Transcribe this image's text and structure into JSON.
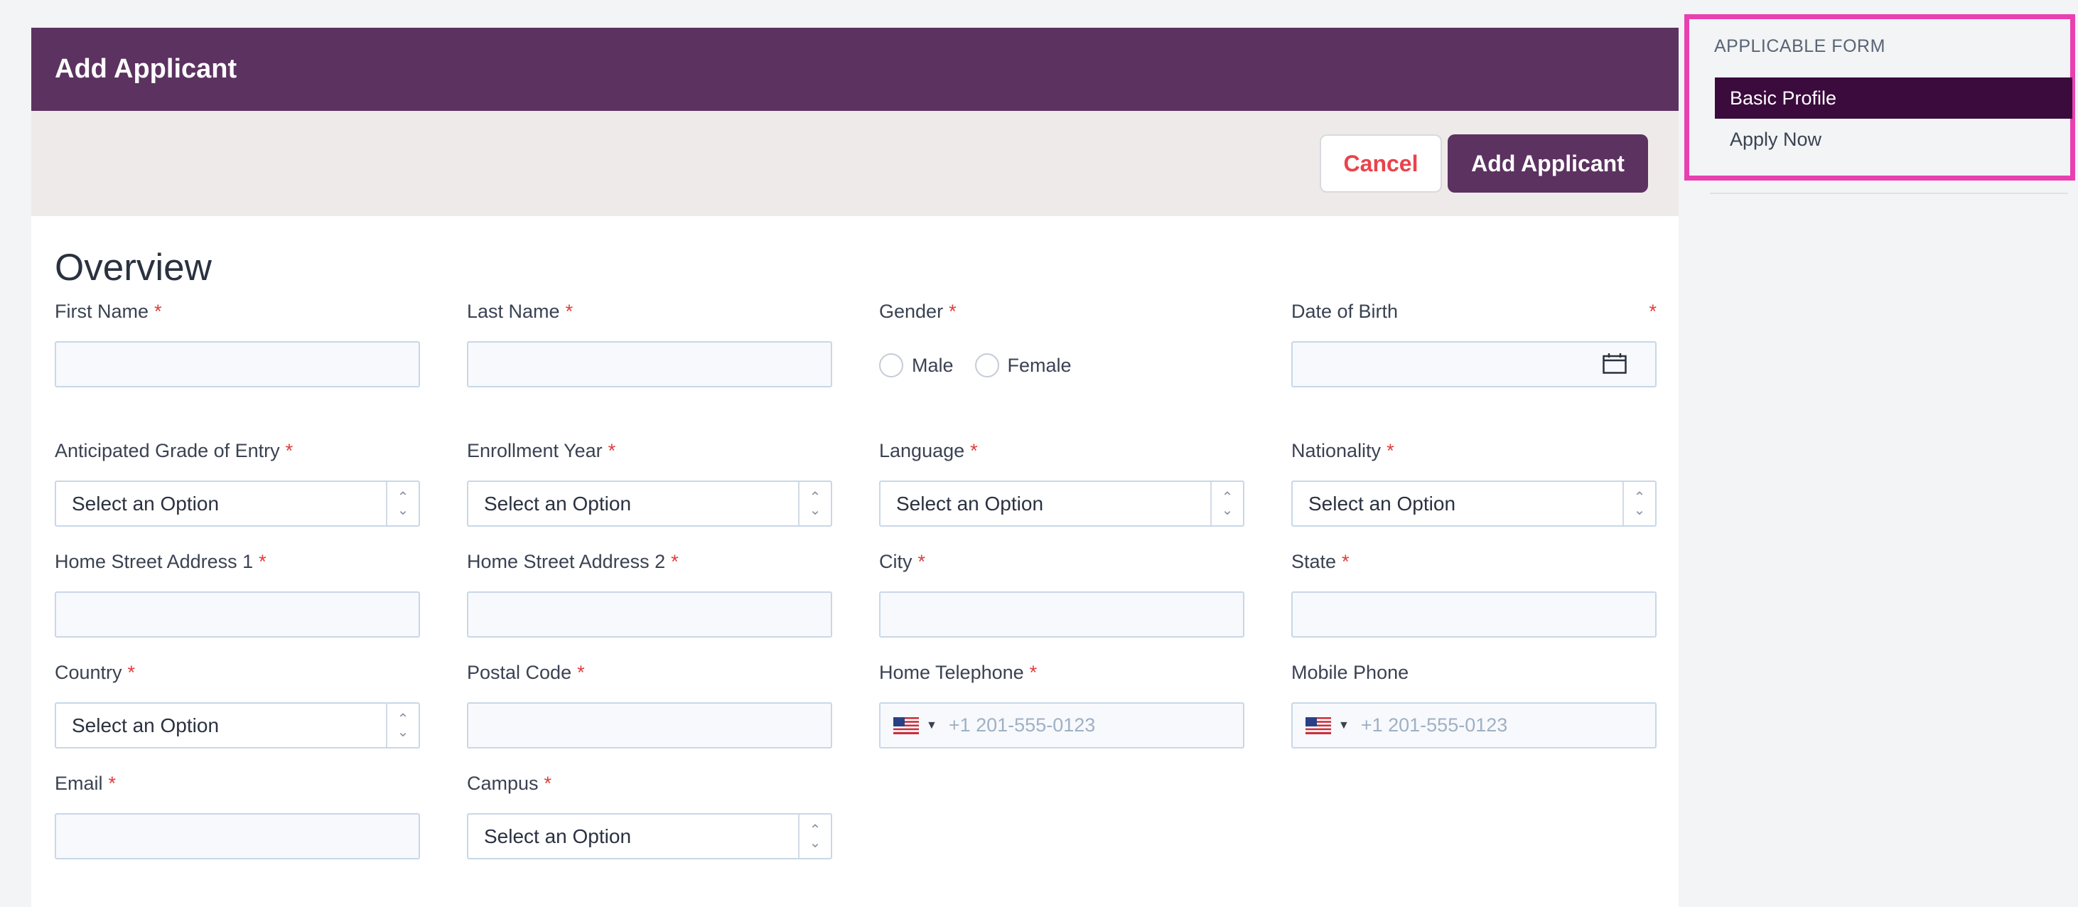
{
  "header": {
    "title": "Add Applicant"
  },
  "toolbar": {
    "cancel_label": "Cancel",
    "add_label": "Add Applicant"
  },
  "section": {
    "title": "Overview"
  },
  "required_mark": "*",
  "fields": {
    "first_name": {
      "label": "First Name",
      "value": ""
    },
    "last_name": {
      "label": "Last Name",
      "value": ""
    },
    "gender": {
      "label": "Gender",
      "options": [
        "Male",
        "Female"
      ],
      "selected": ""
    },
    "dob": {
      "label": "Date of Birth",
      "value": ""
    },
    "grade": {
      "label": "Anticipated Grade of Entry",
      "value": "Select an Option"
    },
    "enrollment_year": {
      "label": "Enrollment Year",
      "value": "Select an Option"
    },
    "language": {
      "label": "Language",
      "value": "Select an Option"
    },
    "nationality": {
      "label": "Nationality",
      "value": "Select an Option"
    },
    "address1": {
      "label": "Home Street Address 1",
      "value": ""
    },
    "address2": {
      "label": "Home Street Address 2",
      "value": ""
    },
    "city": {
      "label": "City",
      "value": ""
    },
    "state": {
      "label": "State",
      "value": ""
    },
    "country": {
      "label": "Country",
      "value": "Select an Option"
    },
    "postal_code": {
      "label": "Postal Code",
      "value": ""
    },
    "home_phone": {
      "label": "Home Telephone",
      "placeholder": "+1 201-555-0123"
    },
    "mobile_phone": {
      "label": "Mobile Phone",
      "placeholder": "+1 201-555-0123"
    },
    "email": {
      "label": "Email",
      "value": ""
    },
    "campus": {
      "label": "Campus",
      "value": "Select an Option"
    }
  },
  "sidebar": {
    "title": "APPLICABLE FORM",
    "items": [
      {
        "label": "Basic Profile",
        "active": true
      },
      {
        "label": "Apply Now",
        "active": false
      }
    ]
  },
  "colors": {
    "brand": "#5c3260",
    "active_item": "#3a0b3c",
    "required": "#e23b3b",
    "cancel_text": "#e9434b",
    "highlight_border": "#e840b0"
  }
}
